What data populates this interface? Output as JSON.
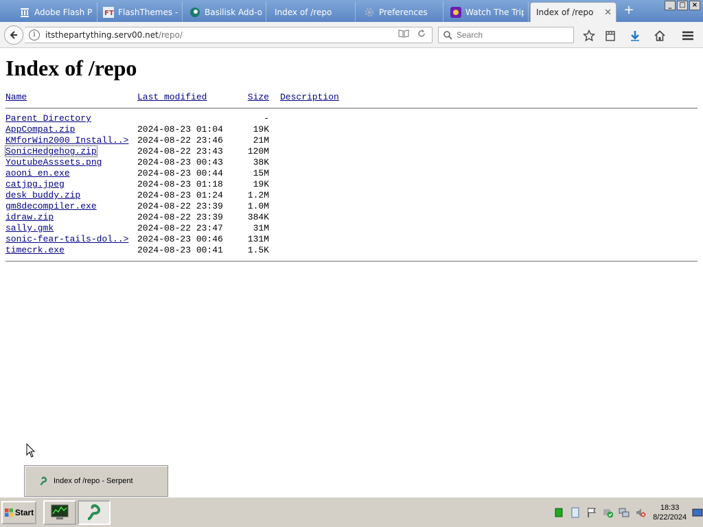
{
  "browser": {
    "tabs": [
      {
        "label": "Adobe Flash Play",
        "icon": "building-icon",
        "active": false
      },
      {
        "label": "FlashThemes - Ho",
        "icon": "flashthemes-icon",
        "active": false
      },
      {
        "label": "Basilisk Add-ons",
        "icon": "basilisk-icon",
        "active": false
      },
      {
        "label": "Index of /repo",
        "icon": "none",
        "active": false
      },
      {
        "label": "Preferences",
        "icon": "gear-icon",
        "active": false
      },
      {
        "label": "Watch The Triple",
        "icon": "video-icon",
        "active": false
      },
      {
        "label": "Index of /repo",
        "icon": "none",
        "active": true
      }
    ],
    "new_tab_symbol": "+",
    "window_buttons": [
      "_",
      "□",
      "×"
    ],
    "url_host": "itsthepartything.serv00.net",
    "url_prefix": "",
    "url_path": "/repo/",
    "search_placeholder": "Search"
  },
  "page": {
    "title": "Index of /repo",
    "columns": {
      "name": "Name",
      "last_modified": "Last modified",
      "size": "Size",
      "description": "Description"
    },
    "parent": {
      "name": "Parent Directory",
      "size": "-"
    },
    "files": [
      {
        "name": "AppCompat.zip",
        "modified": "2024-08-23 01:04",
        "size": "19K"
      },
      {
        "name": "KMforWin2000 Install..>",
        "modified": "2024-08-22 23:46",
        "size": "21M"
      },
      {
        "name": "SonicHedgehog.zip",
        "modified": "2024-08-22 23:43",
        "size": "120M"
      },
      {
        "name": "YoutubeAsssets.png",
        "modified": "2024-08-23 00:43",
        "size": "38K"
      },
      {
        "name": "aooni en.exe",
        "modified": "2024-08-23 00:44",
        "size": "15M"
      },
      {
        "name": "catjpg.jpeg",
        "modified": "2024-08-23 01:18",
        "size": "19K"
      },
      {
        "name": "desk buddy.zip",
        "modified": "2024-08-23 01:24",
        "size": "1.2M"
      },
      {
        "name": "gm8decompiler.exe",
        "modified": "2024-08-22 23:39",
        "size": "1.0M"
      },
      {
        "name": "idraw.zip",
        "modified": "2024-08-22 23:39",
        "size": "384K"
      },
      {
        "name": "sally.gmk",
        "modified": "2024-08-22 23:47",
        "size": "31M"
      },
      {
        "name": "sonic-fear-tails-dol..>",
        "modified": "2024-08-23 00:46",
        "size": "131M"
      },
      {
        "name": "timecrk.exe",
        "modified": "2024-08-23 00:41",
        "size": "1.5K"
      }
    ],
    "link_color": "#00008b"
  },
  "taskbar": {
    "start_label": "Start",
    "popup_label": "Index of /repo - Serpent",
    "clock_time": "18:33",
    "clock_date": "8/22/2024"
  }
}
